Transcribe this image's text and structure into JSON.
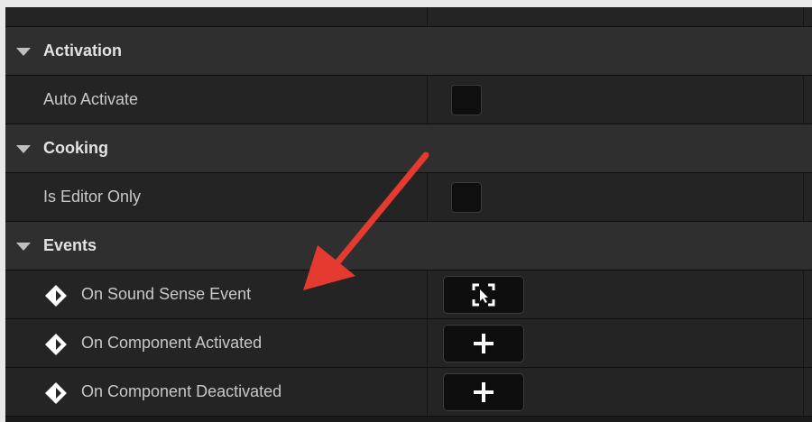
{
  "categories": {
    "activation": {
      "label": "Activation"
    },
    "cooking": {
      "label": "Cooking"
    },
    "events": {
      "label": "Events"
    }
  },
  "properties": {
    "auto_activate": {
      "label": "Auto Activate",
      "checked": false
    },
    "is_editor_only": {
      "label": "Is Editor Only",
      "checked": false
    }
  },
  "events": [
    {
      "label": "On Sound Sense Event",
      "button_icon": "select-bind-icon"
    },
    {
      "label": "On Component Activated",
      "button_icon": "plus-icon"
    },
    {
      "label": "On Component Deactivated",
      "button_icon": "plus-icon"
    }
  ],
  "colors": {
    "annotation_arrow": "#e53a2f",
    "accent_blue": "#2d6fd1"
  }
}
